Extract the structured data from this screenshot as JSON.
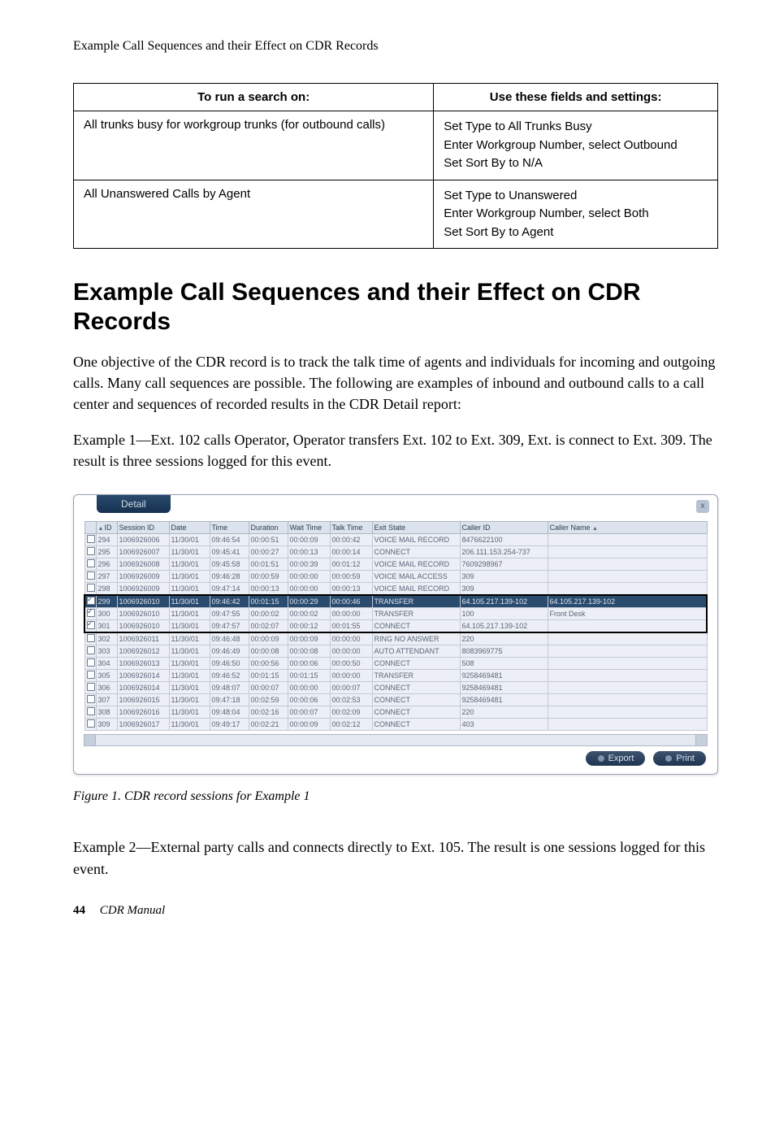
{
  "running_header": "Example Call Sequences and their Effect on CDR Records",
  "search_table": {
    "headers": [
      "To run a search on:",
      "Use these fields and settings:"
    ],
    "rows": [
      {
        "left": "All trunks busy for workgroup trunks (for outbound calls)",
        "right": [
          "Set Type to All Trunks Busy",
          "Enter Workgroup Number, select Outbound",
          "Set Sort By to N/A"
        ]
      },
      {
        "left": "All Unanswered Calls by Agent",
        "right": [
          "Set Type to Unanswered",
          "Enter Workgroup Number, select Both",
          "Set Sort By to Agent"
        ]
      }
    ]
  },
  "heading": "Example Call Sequences and their Effect on CDR Records",
  "para1": "One objective of the CDR record is to track the talk time of agents and individuals for incoming and outgoing calls. Many call sequences are possible. The following are examples of inbound and outbound calls to a call center and sequences of recorded results in the CDR Detail report:",
  "para2": "Example 1—Ext. 102 calls Operator, Operator transfers Ext. 102 to Ext. 309, Ext. is connect to Ext. 309. The result is three sessions logged for this event.",
  "para3": "Example 2—External party calls and connects directly to Ext. 105. The result is one sessions logged for this event.",
  "detail": {
    "tab_label": "Detail",
    "close_label": "x",
    "export_label": "Export",
    "print_label": "Print",
    "columns": [
      "",
      "ID",
      "Session ID",
      "Date",
      "Time",
      "Duration",
      "Wait Time",
      "Talk Time",
      "Exit State",
      "Caller ID",
      "Caller Name"
    ],
    "rows": [
      {
        "chk": false,
        "id": "294",
        "sess": "1006926006",
        "date": "11/30/01",
        "time": "09:46:54",
        "dur": "00:00:51",
        "wait": "00:00:09",
        "talk": "00:00:42",
        "exit": "VOICE MAIL RECORD",
        "cid": "8476622100",
        "cname": ""
      },
      {
        "chk": false,
        "id": "295",
        "sess": "1006926007",
        "date": "11/30/01",
        "time": "09:45:41",
        "dur": "00:00:27",
        "wait": "00:00:13",
        "talk": "00:00:14",
        "exit": "CONNECT",
        "cid": "206.111.153.254-737",
        "cname": ""
      },
      {
        "chk": false,
        "id": "296",
        "sess": "1006926008",
        "date": "11/30/01",
        "time": "09:45:58",
        "dur": "00:01:51",
        "wait": "00:00:39",
        "talk": "00:01:12",
        "exit": "VOICE MAIL RECORD",
        "cid": "7609298967",
        "cname": ""
      },
      {
        "chk": false,
        "id": "297",
        "sess": "1006926009",
        "date": "11/30/01",
        "time": "09:46:28",
        "dur": "00:00:59",
        "wait": "00:00:00",
        "talk": "00:00:59",
        "exit": "VOICE MAIL ACCESS",
        "cid": "309",
        "cname": ""
      },
      {
        "chk": false,
        "id": "298",
        "sess": "1006926009",
        "date": "11/30/01",
        "time": "09:47:14",
        "dur": "00:00:13",
        "wait": "00:00:00",
        "talk": "00:00:13",
        "exit": "VOICE MAIL RECORD",
        "cid": "309",
        "cname": ""
      },
      {
        "chk": true,
        "sel": true,
        "grp": "top",
        "id": "299",
        "sess": "1006926010",
        "date": "11/30/01",
        "time": "09:46:42",
        "dur": "00:01:15",
        "wait": "00:00:29",
        "talk": "00:00:46",
        "exit": "TRANSFER",
        "cid": "64.105.217.139-102",
        "cname": "64.105.217.139-102"
      },
      {
        "chk": true,
        "grp": "mid",
        "id": "300",
        "sess": "1006926010",
        "date": "11/30/01",
        "time": "09:47:55",
        "dur": "00:00:02",
        "wait": "00:00:02",
        "talk": "00:00:00",
        "exit": "TRANSFER",
        "cid": "100",
        "cname": "Front Desk"
      },
      {
        "chk": true,
        "grp": "bot",
        "id": "301",
        "sess": "1006926010",
        "date": "11/30/01",
        "time": "09:47:57",
        "dur": "00:02:07",
        "wait": "00:00:12",
        "talk": "00:01:55",
        "exit": "CONNECT",
        "cid": "64.105.217.139-102",
        "cname": ""
      },
      {
        "chk": false,
        "id": "302",
        "sess": "1006926011",
        "date": "11/30/01",
        "time": "09:46:48",
        "dur": "00:00:09",
        "wait": "00:00:09",
        "talk": "00:00:00",
        "exit": "RING NO ANSWER",
        "cid": "220",
        "cname": ""
      },
      {
        "chk": false,
        "id": "303",
        "sess": "1006926012",
        "date": "11/30/01",
        "time": "09:46:49",
        "dur": "00:00:08",
        "wait": "00:00:08",
        "talk": "00:00:00",
        "exit": "AUTO ATTENDANT",
        "cid": "8083969775",
        "cname": ""
      },
      {
        "chk": false,
        "id": "304",
        "sess": "1006926013",
        "date": "11/30/01",
        "time": "09:46:50",
        "dur": "00:00:56",
        "wait": "00:00:06",
        "talk": "00:00:50",
        "exit": "CONNECT",
        "cid": "508",
        "cname": ""
      },
      {
        "chk": false,
        "id": "305",
        "sess": "1006926014",
        "date": "11/30/01",
        "time": "09:46:52",
        "dur": "00:01:15",
        "wait": "00:01:15",
        "talk": "00:00:00",
        "exit": "TRANSFER",
        "cid": "9258469481",
        "cname": ""
      },
      {
        "chk": false,
        "id": "306",
        "sess": "1006926014",
        "date": "11/30/01",
        "time": "09:48:07",
        "dur": "00:00:07",
        "wait": "00:00:00",
        "talk": "00:00:07",
        "exit": "CONNECT",
        "cid": "9258469481",
        "cname": ""
      },
      {
        "chk": false,
        "id": "307",
        "sess": "1006926015",
        "date": "11/30/01",
        "time": "09:47:18",
        "dur": "00:02:59",
        "wait": "00:00:06",
        "talk": "00:02:53",
        "exit": "CONNECT",
        "cid": "9258469481",
        "cname": ""
      },
      {
        "chk": false,
        "id": "308",
        "sess": "1006926016",
        "date": "11/30/01",
        "time": "09:48:04",
        "dur": "00:02:16",
        "wait": "00:00:07",
        "talk": "00:02:09",
        "exit": "CONNECT",
        "cid": "220",
        "cname": ""
      },
      {
        "chk": false,
        "id": "309",
        "sess": "1006926017",
        "date": "11/30/01",
        "time": "09:49:17",
        "dur": "00:02:21",
        "wait": "00:00:09",
        "talk": "00:02:12",
        "exit": "CONNECT",
        "cid": "403",
        "cname": ""
      }
    ]
  },
  "figure_caption": "Figure 1.    CDR record sessions for Example 1",
  "footer": {
    "page": "44",
    "book": "CDR Manual"
  }
}
